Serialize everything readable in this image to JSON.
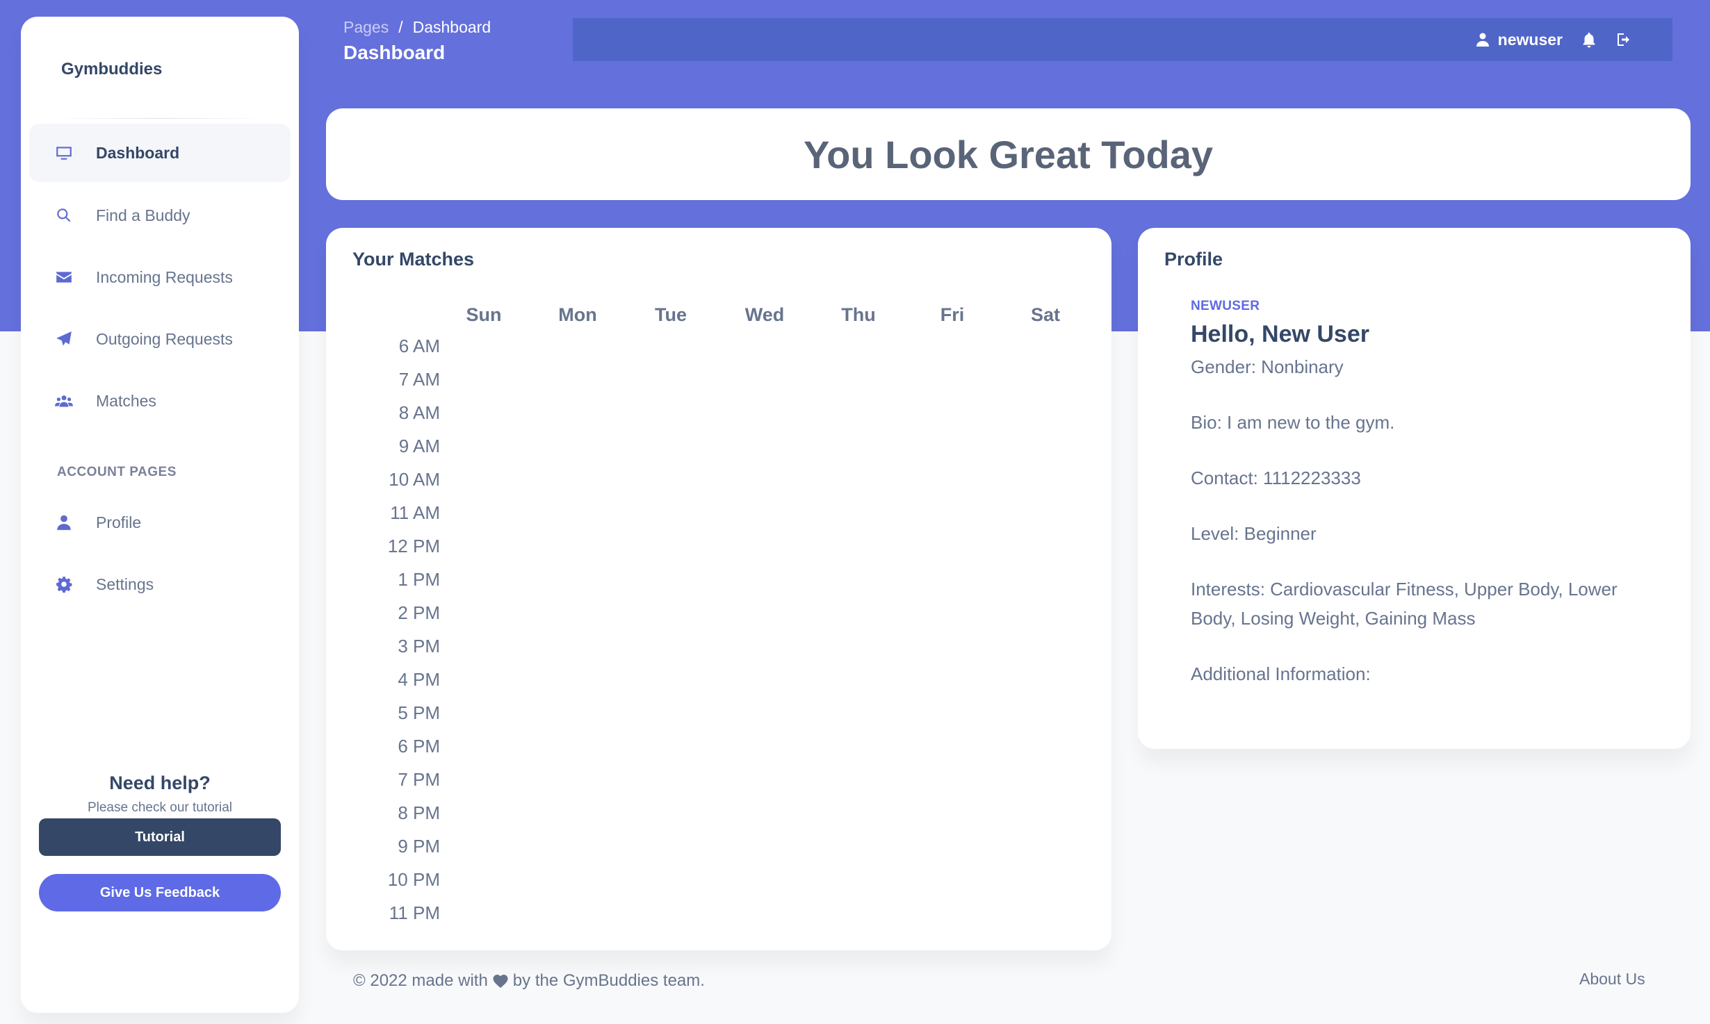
{
  "app": {
    "brand": "Gymbuddies"
  },
  "sidebar": {
    "items": [
      {
        "label": "Dashboard",
        "icon": "monitor-icon",
        "active": true
      },
      {
        "label": "Find a Buddy",
        "icon": "search-icon"
      },
      {
        "label": "Incoming Requests",
        "icon": "envelope-icon"
      },
      {
        "label": "Outgoing Requests",
        "icon": "paper-plane-icon"
      },
      {
        "label": "Matches",
        "icon": "users-icon"
      }
    ],
    "section_title": "ACCOUNT PAGES",
    "account_items": [
      {
        "label": "Profile",
        "icon": "user-icon"
      },
      {
        "label": "Settings",
        "icon": "gear-icon"
      }
    ],
    "help": {
      "title": "Need help?",
      "subtitle": "Please check our tutorial",
      "tutorial_label": "Tutorial",
      "feedback_label": "Give Us Feedback"
    }
  },
  "header": {
    "breadcrumb": [
      "Pages",
      "/",
      "Dashboard"
    ],
    "title": "Dashboard",
    "username": "newuser"
  },
  "banner": {
    "text": "You Look Great Today"
  },
  "matches": {
    "title": "Your Matches",
    "days": [
      "Sun",
      "Mon",
      "Tue",
      "Wed",
      "Thu",
      "Fri",
      "Sat"
    ],
    "times": [
      "6 AM",
      "7 AM",
      "8 AM",
      "9 AM",
      "10 AM",
      "11 AM",
      "12 PM",
      "1 PM",
      "2 PM",
      "3 PM",
      "4 PM",
      "5 PM",
      "6 PM",
      "7 PM",
      "8 PM",
      "9 PM",
      "10 PM",
      "11 PM"
    ]
  },
  "profile": {
    "title": "Profile",
    "username": "NEWUSER",
    "hello": "Hello, New User",
    "gender": "Gender: Nonbinary",
    "bio": "Bio: I am new to the gym.",
    "contact": "Contact: 1112223333",
    "level": "Level: Beginner",
    "interests": "Interests: Cardiovascular Fitness, Upper Body, Lower Body, Losing Weight, Gaining Mass",
    "additional": "Additional Information:"
  },
  "footer": {
    "prefix": "© 2022 made with",
    "suffix": "by the GymBuddies team.",
    "about": "About Us"
  },
  "colors": {
    "primary": "#6470dc",
    "dark": "#344767",
    "accent": "#5e6ae6"
  }
}
